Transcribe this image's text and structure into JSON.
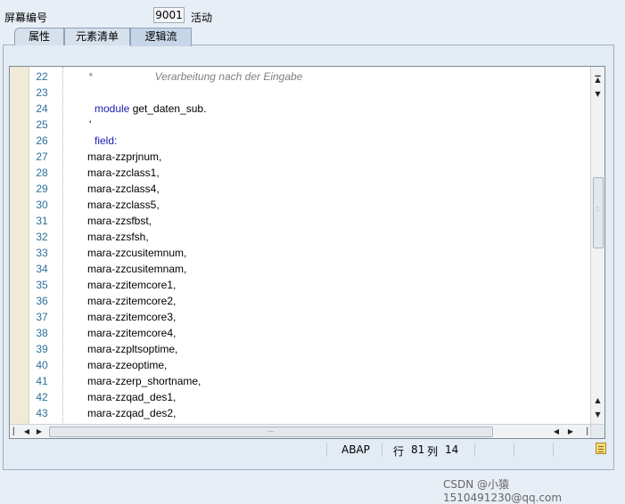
{
  "header": {
    "screen_label": "屏幕编号",
    "screen_number": "9001",
    "status": "活动"
  },
  "tabs": [
    {
      "label": "属性",
      "active": false
    },
    {
      "label": "元素清单",
      "active": false
    },
    {
      "label": "逻辑流",
      "active": true
    }
  ],
  "editor": {
    "lines": [
      {
        "num": "22",
        "text": "*                     Verarbeitung nach der Eingabe",
        "kind": "comment",
        "indent": 0
      },
      {
        "num": "23",
        "text": "",
        "kind": "plain",
        "indent": 0
      },
      {
        "num": "24",
        "text": "module get_daten_sub.",
        "kind": "keyword_module",
        "indent": 8
      },
      {
        "num": "25",
        "text": "'",
        "kind": "plain",
        "indent": 0
      },
      {
        "num": "26",
        "text": "field:",
        "kind": "keyword",
        "indent": 8
      },
      {
        "num": "27",
        "text": "mara-zzprjnum,",
        "kind": "plain",
        "indent": 0
      },
      {
        "num": "28",
        "text": "mara-zzclass1,",
        "kind": "plain",
        "indent": 0
      },
      {
        "num": "29",
        "text": "mara-zzclass4,",
        "kind": "plain",
        "indent": 0
      },
      {
        "num": "30",
        "text": "mara-zzclass5,",
        "kind": "plain",
        "indent": 0
      },
      {
        "num": "31",
        "text": "mara-zzsfbst,",
        "kind": "plain",
        "indent": 0
      },
      {
        "num": "32",
        "text": "mara-zzsfsh,",
        "kind": "plain",
        "indent": 0
      },
      {
        "num": "33",
        "text": "mara-zzcusitemnum,",
        "kind": "plain",
        "indent": 0
      },
      {
        "num": "34",
        "text": "mara-zzcusitemnam,",
        "kind": "plain",
        "indent": 0
      },
      {
        "num": "35",
        "text": "mara-zzitemcore1,",
        "kind": "plain",
        "indent": 0
      },
      {
        "num": "36",
        "text": "mara-zzitemcore2,",
        "kind": "plain",
        "indent": 0
      },
      {
        "num": "37",
        "text": "mara-zzitemcore3,",
        "kind": "plain",
        "indent": 0
      },
      {
        "num": "38",
        "text": "mara-zzitemcore4,",
        "kind": "plain",
        "indent": 0
      },
      {
        "num": "39",
        "text": "mara-zzpltsoptime,",
        "kind": "plain",
        "indent": 0
      },
      {
        "num": "40",
        "text": "mara-zzeoptime,",
        "kind": "plain",
        "indent": 0
      },
      {
        "num": "41",
        "text": "mara-zzerp_shortname,",
        "kind": "plain",
        "indent": 0
      },
      {
        "num": "42",
        "text": "mara-zzqad_des1,",
        "kind": "plain",
        "indent": 0
      },
      {
        "num": "43",
        "text": "mara-zzqad_des2,",
        "kind": "plain",
        "indent": 0
      }
    ]
  },
  "status_bar": {
    "language": "ABAP",
    "row_label": "行",
    "row": "81",
    "col_label": "列",
    "col": "14"
  },
  "watermark": "CSDN @小猿 1510491230@qq.com",
  "icons": {
    "scroll_up": "up-arrow",
    "scroll_down": "down-arrow",
    "scroll_left": "left-arrow",
    "scroll_right": "right-arrow",
    "note": "note-icon"
  },
  "colors": {
    "line_number": "#2c6f96",
    "keyword": "#1a1ab0",
    "comment": "#808080",
    "marker_column": "#f2ead8"
  }
}
